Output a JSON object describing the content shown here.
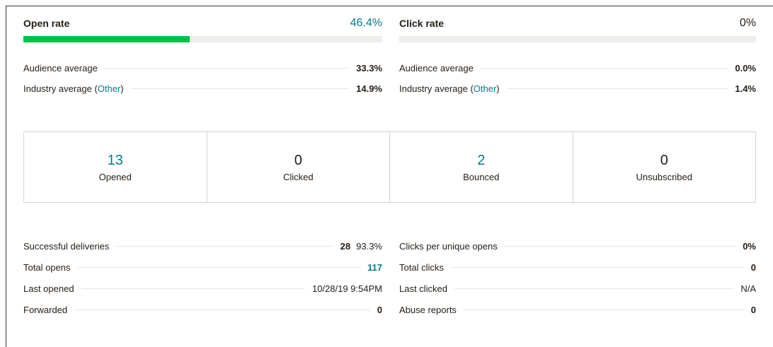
{
  "open_rate": {
    "title": "Open rate",
    "value": "46.4%",
    "fill_fraction": 0.464,
    "bar_color": "#00c04a",
    "audience_label": "Audience average",
    "audience_value": "33.3%",
    "industry_prefix": "Industry average (",
    "industry_link": "Other",
    "industry_suffix": ")",
    "industry_value": "14.9%"
  },
  "click_rate": {
    "title": "Click rate",
    "value": "0%",
    "fill_fraction": 0,
    "audience_label": "Audience average",
    "audience_value": "0.0%",
    "industry_prefix": "Industry average (",
    "industry_link": "Other",
    "industry_suffix": ")",
    "industry_value": "1.4%"
  },
  "summary_boxes": [
    {
      "value": "13",
      "label": "Opened",
      "accent": "teal"
    },
    {
      "value": "0",
      "label": "Clicked",
      "accent": "dark"
    },
    {
      "value": "2",
      "label": "Bounced",
      "accent": "teal"
    },
    {
      "value": "0",
      "label": "Unsubscribed",
      "accent": "dark"
    }
  ],
  "left_stats": [
    {
      "label": "Successful deliveries",
      "value": "28",
      "extra": "93.3%"
    },
    {
      "label": "Total opens",
      "value": "117"
    },
    {
      "label": "Last opened",
      "value": "10/28/19 9:54PM"
    },
    {
      "label": "Forwarded",
      "value": "0"
    }
  ],
  "right_stats": [
    {
      "label": "Clicks per unique opens",
      "value": "0%"
    },
    {
      "label": "Total clicks",
      "value": "0"
    },
    {
      "label": "Last clicked",
      "value": "N/A"
    },
    {
      "label": "Abuse reports",
      "value": "0"
    }
  ],
  "colors": {
    "accent_teal": "#007c89",
    "progress_green": "#00c04a",
    "track": "#efeeea"
  }
}
